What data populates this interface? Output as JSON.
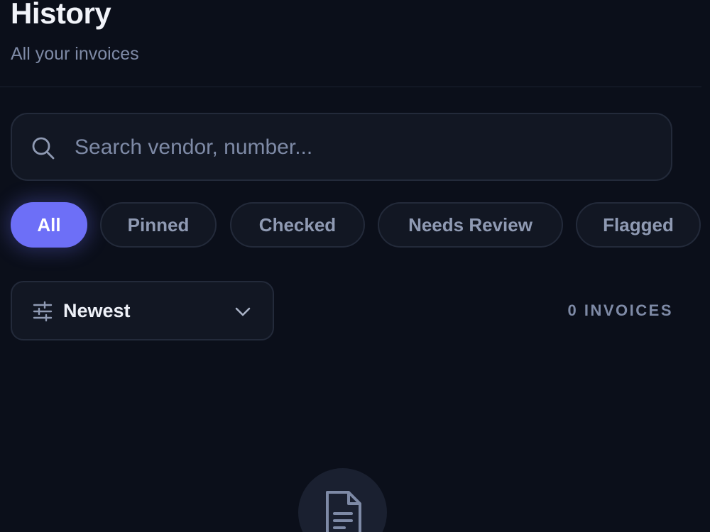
{
  "header": {
    "title": "History",
    "subtitle": "All your invoices"
  },
  "search": {
    "placeholder": "Search vendor, number...",
    "value": "",
    "icon": "search-icon"
  },
  "filters": {
    "active": "All",
    "chips": [
      {
        "label": "All"
      },
      {
        "label": "Pinned"
      },
      {
        "label": "Checked"
      },
      {
        "label": "Needs Review"
      },
      {
        "label": "Flagged"
      }
    ]
  },
  "sort": {
    "label": "Newest",
    "icon": "sliders-icon",
    "chevron": "chevron-down-icon"
  },
  "count": {
    "label": "0 INVOICES"
  },
  "empty_state": {
    "icon": "document-icon"
  },
  "colors": {
    "background": "#0b0f1a",
    "surface": "#121723",
    "border": "#232a3a",
    "accent": "#6d6ff7",
    "muted_text": "#7e8aa6",
    "chip_text": "#8f9ab3"
  }
}
